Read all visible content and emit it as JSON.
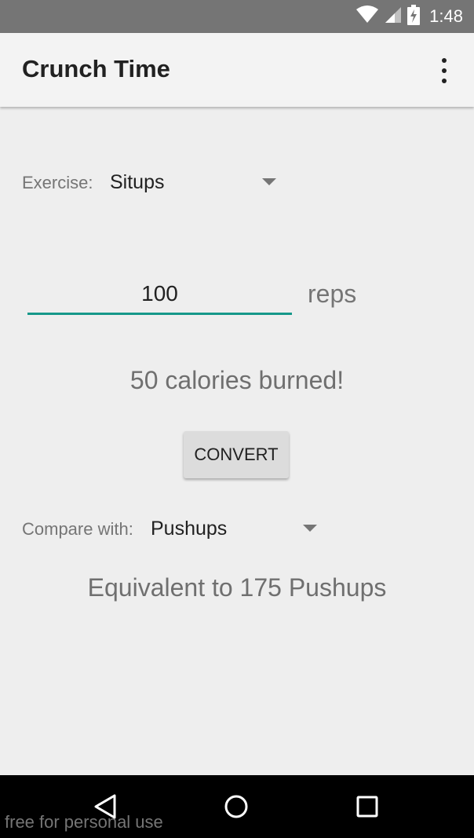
{
  "status_bar": {
    "time": "1:48",
    "icons": [
      "wifi-icon",
      "signal-icon",
      "battery-charging-icon"
    ]
  },
  "app_bar": {
    "title": "Crunch Time",
    "menu_icon": "overflow-menu-icon"
  },
  "exercise": {
    "label": "Exercise:",
    "selected": "Situps"
  },
  "reps": {
    "value": "100",
    "unit": "reps"
  },
  "calories": {
    "text": "50 calories burned!"
  },
  "convert_button": {
    "label": "CONVERT"
  },
  "compare": {
    "label": "Compare with:",
    "selected": "Pushups"
  },
  "equivalent": {
    "text": "Equivalent to 175 Pushups"
  },
  "nav_bar": {
    "buttons": [
      "back-icon",
      "home-icon",
      "recents-icon"
    ]
  },
  "watermark": {
    "text": "free for personal use"
  },
  "colors": {
    "accent": "#16988a",
    "status_bar": "#757575",
    "app_bar": "#f3f3f3",
    "background": "#eeeeee",
    "nav_bar": "#000000"
  }
}
